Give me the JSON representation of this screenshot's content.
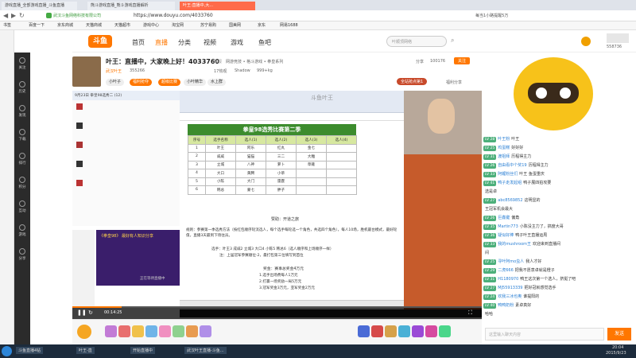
{
  "browser": {
    "tabs": [
      "游戏直播_全部游戏直播_斗鱼直播",
      "熊斗游戏直播_熊斗游戏直播解析",
      "叶王:直播中,大..."
    ],
    "url": "https://www.douyu.com/4033760",
    "site_owner": "武汉斗鱼网络科技有限公司",
    "top_right_text": "每当1小路提醒5万",
    "bookmarks": [
      "书签",
      "百度一下",
      "京东商城",
      "天猫商城",
      "天猫超市",
      "游戏中心",
      "淘宝网",
      "苏宁易购",
      "国美网",
      "京东",
      "网易1688"
    ]
  },
  "nav": {
    "logo": "斗鱼",
    "items": [
      "首页",
      "直播",
      "分类",
      "视频",
      "游戏",
      "鱼吧"
    ],
    "search_placeholder": "叶顺顶网络",
    "user_count": "558736"
  },
  "side": [
    "关注",
    "历史",
    "发现",
    "下载",
    "排行",
    "积分",
    "互动",
    "游戏",
    "分享"
  ],
  "room": {
    "title": "叶王：直播中，大家晚上好！4033760",
    "report": "举报",
    "category": "网游竞技 • 格斗游戏 • 拳皇系列",
    "host": "叶王",
    "fans_label": "武汉叶王",
    "id_label": "355266",
    "hotness": "17热观",
    "rank": "Shadow",
    "fans": "999+kg",
    "follow_count": "100176",
    "follow_btn": "关注",
    "share": "分享",
    "tags": [
      "小叶子",
      "福利抢夺",
      "超级比赛",
      "小叶精华",
      "水上群"
    ],
    "rank_btn": "全站抢点第1",
    "fans_share": "福利分享"
  },
  "video": {
    "chatgroup_title": "9月23日 拳皇98选秀二 (12)",
    "sheet_title": "拳皇98选秀比赛第二季",
    "headers": [
      "序号",
      "选手名称",
      "选人(1)",
      "选人(2)",
      "选人(3)",
      "选人(4)"
    ],
    "rows": [
      [
        "1",
        "叶王",
        "阿乐",
        "红丸",
        "金七",
        ""
      ],
      [
        "2",
        "威威",
        "猫猫",
        "三二",
        "大雕",
        ""
      ],
      [
        "3",
        "立城",
        "八神",
        "萝卜",
        "草薙",
        ""
      ],
      [
        "4",
        "大口",
        "黄腾",
        "小草",
        "",
        ""
      ],
      [
        "5",
        "小陈",
        "大门",
        "雷霆",
        "",
        ""
      ],
      [
        "6",
        "韩总",
        "蒙七",
        "胖子",
        "",
        ""
      ]
    ],
    "sponsor": "赞助：开道之旅",
    "rule1": "规则：参赛第一季选秀方法（按红包顺序轮流选人，每个选手每轮选一个角色，共选四个角色），每人10场，胜机最台模式，最好轮值，直播3天最到下场往员。",
    "rule2": "选手：叶王3 成威2 立城3 大口4 小陈5 韩总6（选人顺序和上场顺序一样）",
    "rule3": "注：上届冠军参赛顺位-2，最打包第三位填写到首位",
    "prize_title": "奖金：赛事总奖金4万元",
    "prizes": [
      "1.选手出场费每人1万元",
      "2.打赢一场奖励一局5万元",
      "3.冠军奖金3万元，亚军奖金2万元"
    ],
    "promo": "《拳皇98》 最好有人知识分享",
    "promo_sub": "正在等待直播中",
    "watermark": "斗鱼叶王",
    "time": "00:14:25"
  },
  "chat": {
    "rows": [
      {
        "lv": "LV 28",
        "name": "叶王粉",
        "msg": "叶王"
      },
      {
        "lv": "LV 25",
        "name": "鸡蛋糕",
        "msg": "好好好"
      },
      {
        "lv": "LV 31",
        "name": "渡祖拜",
        "msg": "历程得主力"
      },
      {
        "lv": "LV 26",
        "name": "自由看中个奖19",
        "msg": "历程得主力"
      },
      {
        "lv": "LV 33",
        "name": "阿鲤粉丝们",
        "msg": "叶王 鱼蛋重庆"
      },
      {
        "lv": "LV 41",
        "name": "鸭子走发起组",
        "msg": "鸭子展四拍攻要"
      },
      {
        "lv": "",
        "name": "",
        "msg": "选是卓"
      },
      {
        "lv": "LV 27",
        "name": "abc8569852",
        "msg": "这明显的"
      },
      {
        "lv": "",
        "name": "",
        "msg": "王冠军机会最大"
      },
      {
        "lv": "LV 26",
        "name": "巨鑫键",
        "msg": "偏角"
      },
      {
        "lv": "LV 35",
        "name": "Martin773",
        "msg": "小陈没主力了，搞度大哥"
      },
      {
        "lv": "LV 36",
        "name": "疑似好棒",
        "msg": "鸭子叶王直播运周"
      },
      {
        "lv": "LV 33",
        "name": "我的mushroom王",
        "msg": "欢迎来到直播间"
      },
      {
        "lv": "",
        "name": "",
        "msg": "间"
      },
      {
        "lv": "LV 25",
        "name": "寻叶阿mo虫人",
        "msg": "我人才好"
      },
      {
        "lv": "LV 29",
        "name": "二虎666",
        "msg": "把我不愿意卓就是橙子"
      },
      {
        "lv": "LV 31",
        "name": "H1180970",
        "msg": "鸭王这次第一个选人，挤挺了吧"
      },
      {
        "lv": "LV 27",
        "name": "MJ55913339",
        "msg": "把好冠就感觉选手"
      },
      {
        "lv": "LV 24",
        "name": "欢我三冰也奥",
        "msg": "谁提阳的"
      },
      {
        "lv": "LV 40",
        "name": "鸭鸭奶粉",
        "msg": "素卓真好"
      },
      {
        "lv": "",
        "name": "",
        "msg": "哈哈"
      }
    ],
    "input_placeholder": "这里输入聊天内容",
    "send": "发送"
  },
  "taskbar": {
    "items": [
      "斗鱼直播4钻",
      "叶王-直",
      "开始直播中",
      "武汉叶王直播-斗鱼..."
    ],
    "time": "20:04",
    "date": "2015/9/23"
  },
  "colors": {
    "accent": "#ff7700",
    "sheet_head": "#d7e8a0",
    "sheet_title": "#3c8c2d",
    "chat_lv": "#4caf7a"
  }
}
